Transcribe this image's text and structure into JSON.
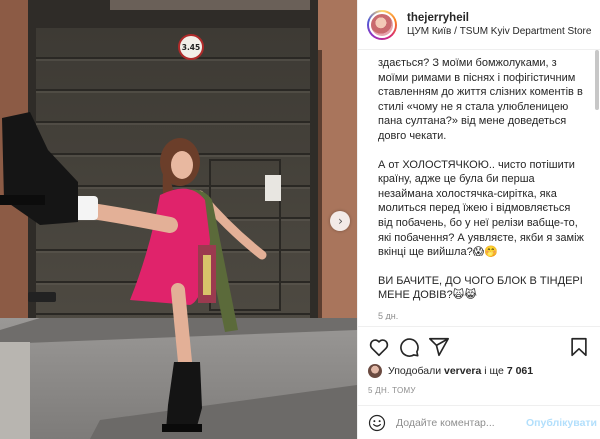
{
  "post": {
    "username": "thejerryheil",
    "location": "ЦУМ Київ / TSUM Kyiv Department Store",
    "caption_paragraphs": [
      "здається? З моїми бомжолуками, з моїми римами в піснях і пофігістичним ставленням до життя слізних коментів в стилі «чому не я стала улюбленицею пана султана?» від мене доведеться довго чекати.",
      "А от ХОЛОСТЯЧКОЮ.. чисто потішити країну, адже це була би перша незаймана холостячка-сирітка, яка молиться перед їжею і відмовляється від побачень, бо у неї релізи вабще-то, які побачення? А уявляєте, якби я заміж вкінці ще вийшла?😱🤭",
      "ВИ БАЧИТЕ, ДО ЧОГО БЛОК В ТІНДЕРІ МЕНЕ ДОВІВ?🙀😹"
    ],
    "caption_date": "5 дн.",
    "likes": {
      "prefix": "Уподобали ",
      "user": "ververa",
      "middle": " і ще ",
      "count": "7 061"
    },
    "time_ago": "5 ДН. ТОМУ",
    "comment": {
      "placeholder": "Додайте коментар...",
      "publish_label": "Опублікувати"
    },
    "photo": {
      "door_sign": "3.45"
    }
  },
  "icons": {
    "like": "heart-icon",
    "comment": "comment-icon",
    "share": "paper-plane-icon",
    "save": "bookmark-icon",
    "emoji": "smiley-icon",
    "next": "chevron-right-icon"
  },
  "colors": {
    "accent_blue_disabled": "#b2dffc",
    "muted_text": "#8e8e8e",
    "text": "#262626",
    "dress_pink": "#e0236b"
  }
}
